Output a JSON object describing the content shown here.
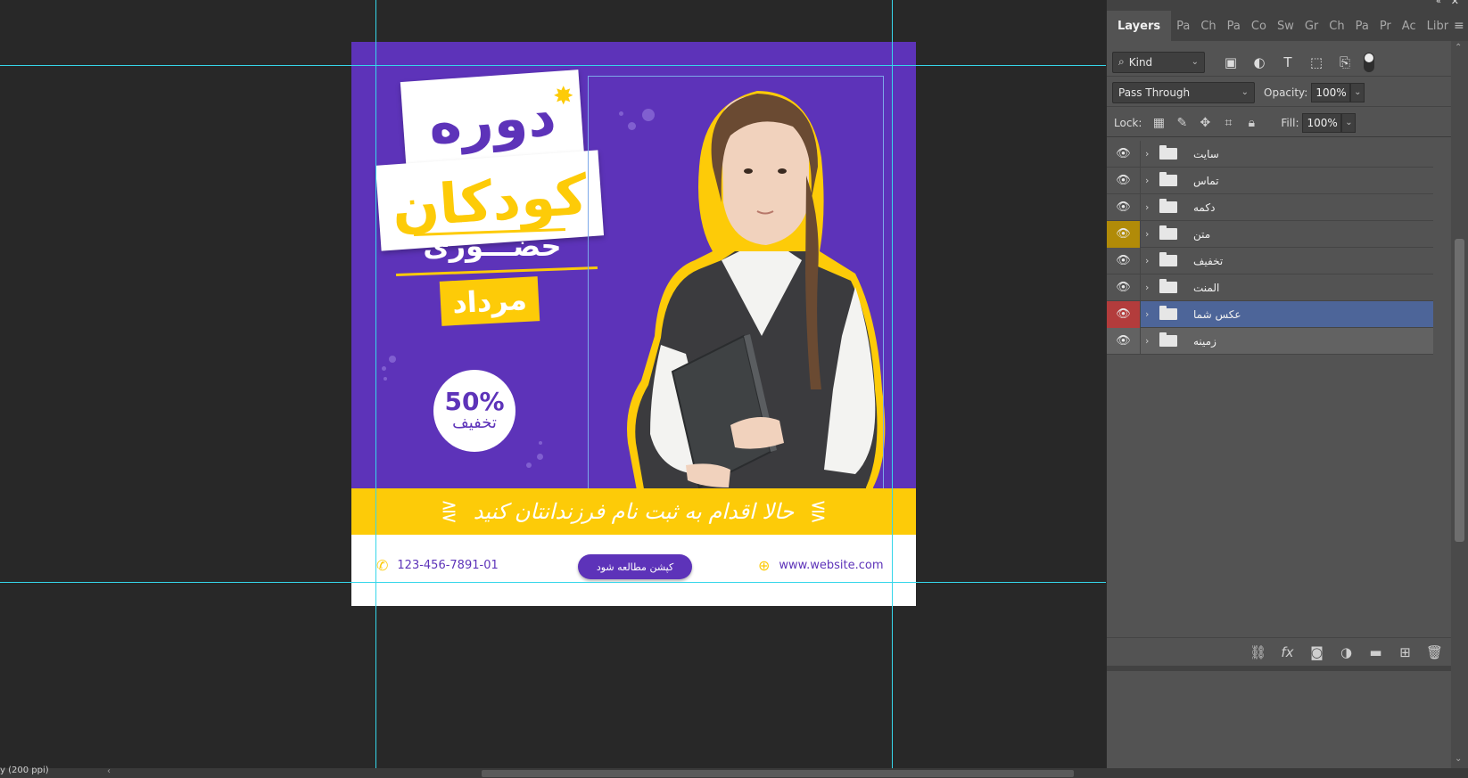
{
  "layers_panel": {
    "tabs": [
      "Layers",
      "Pa",
      "Ch",
      "Pa",
      "Co",
      "Sw",
      "Gr",
      "Ch",
      "Pa",
      "Pr",
      "Ac",
      "Libr"
    ],
    "filter": {
      "kind_label": "Kind"
    },
    "blend": {
      "mode": "Pass Through",
      "opacity_label": "Opacity:",
      "opacity_value": "100%"
    },
    "lock": {
      "label": "Lock:",
      "fill_label": "Fill:",
      "fill_value": "100%"
    },
    "layers": [
      {
        "name": "سایت",
        "eye_color": "default",
        "state": "normal"
      },
      {
        "name": "تماس",
        "eye_color": "default",
        "state": "normal"
      },
      {
        "name": "دکمه",
        "eye_color": "default",
        "state": "normal"
      },
      {
        "name": "متن",
        "eye_color": "yellow",
        "state": "normal"
      },
      {
        "name": "تخفیف",
        "eye_color": "default",
        "state": "normal"
      },
      {
        "name": "المنت",
        "eye_color": "default",
        "state": "normal"
      },
      {
        "name": "عکس شما",
        "eye_color": "red",
        "state": "selected"
      },
      {
        "name": "زمینه",
        "eye_color": "default",
        "state": "hovered"
      }
    ]
  },
  "artwork": {
    "title_top": "دوره",
    "title_main": "کودکان",
    "subtitle": "حضـــوری",
    "month": "مرداد",
    "discount_percent": "50%",
    "discount_label": "تخفیف",
    "band_text": "حالا اقدام به ثبت نام فرزندانتان کنید",
    "phone": "123-456-7891-01",
    "button_label": "کپشن مطالعه شود",
    "website": "www.website.com"
  },
  "status": {
    "zoom_text": "y (200 ppi)"
  },
  "colors": {
    "purple": "#5d33b9",
    "yellow": "#fdcb08",
    "guide": "#36d6ea",
    "selected_layer": "#4d6599"
  }
}
